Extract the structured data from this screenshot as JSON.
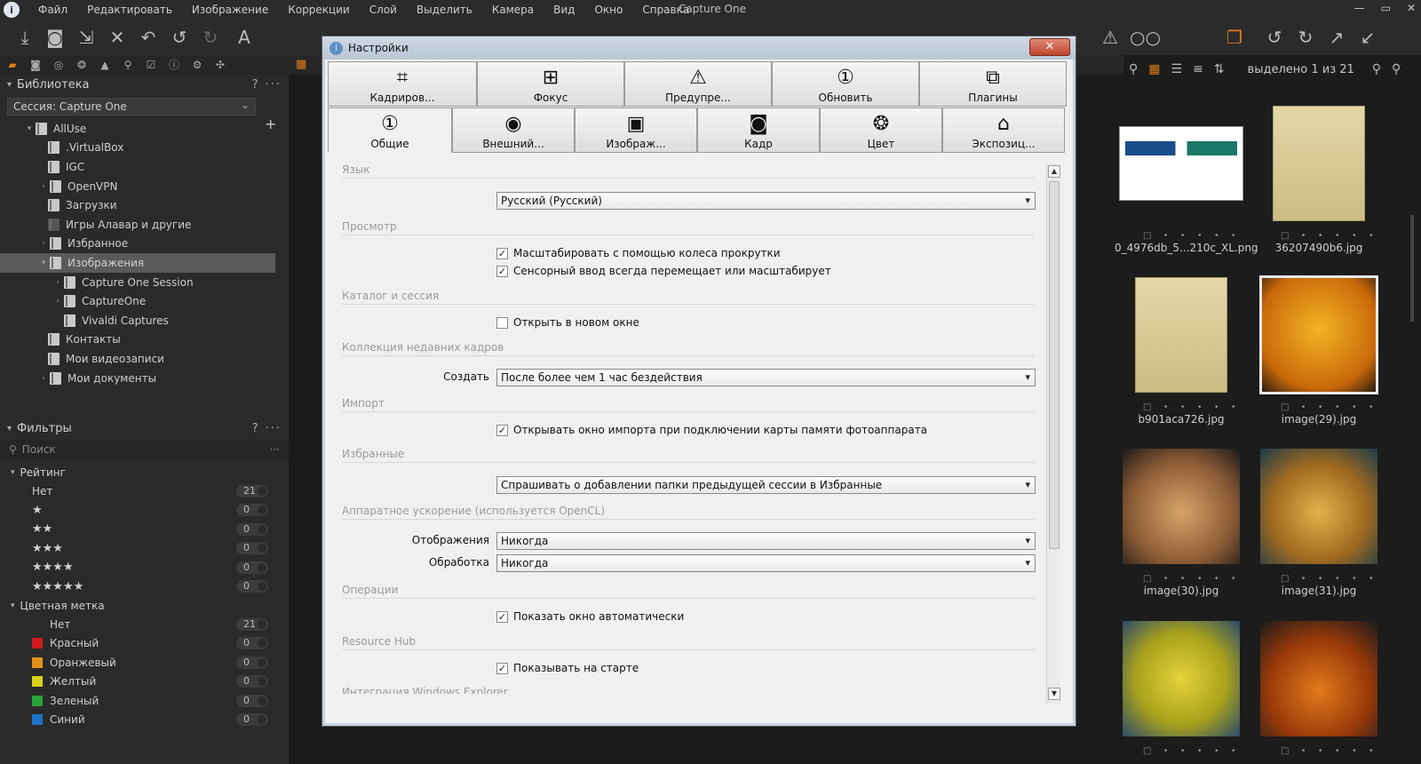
{
  "app": {
    "window_title": "Capture One",
    "menu": [
      "Файл",
      "Редактировать",
      "Изображение",
      "Коррекции",
      "Слой",
      "Выделить",
      "Камера",
      "Вид",
      "Окно",
      "Справка"
    ]
  },
  "library": {
    "header": "Библиотека",
    "session": "Сессия: Capture One",
    "tree": [
      {
        "label": "AllUse",
        "level": 1,
        "expanded": true
      },
      {
        "label": ".VirtualBox",
        "level": 2
      },
      {
        "label": "IGC",
        "level": 2
      },
      {
        "label": "OpenVPN",
        "level": 2,
        "collapsed": true
      },
      {
        "label": "Загрузки",
        "level": 2
      },
      {
        "label": "Игры Алавар и другие",
        "level": 2
      },
      {
        "label": "Избранное",
        "level": 2,
        "collapsed": true
      },
      {
        "label": "Изображения",
        "level": 2,
        "expanded": true,
        "selected": true
      },
      {
        "label": "Capture One Session",
        "level": 3,
        "collapsed": true
      },
      {
        "label": "CaptureOne",
        "level": 3,
        "collapsed": true
      },
      {
        "label": "Vivaldi Captures",
        "level": 3
      },
      {
        "label": "Контакты",
        "level": 2
      },
      {
        "label": "Мои видеозаписи",
        "level": 2
      },
      {
        "label": "Мои документы",
        "level": 2,
        "collapsed": true
      }
    ]
  },
  "filters": {
    "header": "Фильтры",
    "search_placeholder": "Поиск",
    "rating_header": "Рейтинг",
    "rating": [
      {
        "label": "Нет",
        "count": "21"
      },
      {
        "stars": "★",
        "count": "0"
      },
      {
        "stars": "★★",
        "count": "0"
      },
      {
        "stars": "★★★",
        "count": "0"
      },
      {
        "stars": "★★★★",
        "count": "0"
      },
      {
        "stars": "★★★★★",
        "count": "0"
      }
    ],
    "color_header": "Цветная метка",
    "colors": [
      {
        "label": "Нет",
        "count": "21",
        "color": "#2a2a2a"
      },
      {
        "label": "Красный",
        "count": "0",
        "color": "#d11a1a"
      },
      {
        "label": "Оранжевый",
        "count": "0",
        "color": "#e0901a"
      },
      {
        "label": "Желтый",
        "count": "0",
        "color": "#d8d21c"
      },
      {
        "label": "Зеленый",
        "count": "0",
        "color": "#2aa23a"
      },
      {
        "label": "Синий",
        "count": "0",
        "color": "#1e72c8"
      }
    ]
  },
  "browser": {
    "selection": "выделено 1 из 21",
    "thumbs": [
      {
        "name": "0_4976db_5...210c_XL.png"
      },
      {
        "name": "36207490b6.jpg"
      },
      {
        "name": "b901aca726.jpg"
      },
      {
        "name": "image(29).jpg"
      },
      {
        "name": "image(30).jpg"
      },
      {
        "name": "image(31).jpg"
      },
      {
        "name": ""
      },
      {
        "name": ""
      }
    ]
  },
  "dialog": {
    "title": "Настройки",
    "close": "✕",
    "tabs_top": [
      "Кадриров...",
      "Фокус",
      "Предупре...",
      "Обновить",
      "Плагины"
    ],
    "tabs_bottom": [
      "Общие",
      "Внешний...",
      "Изображ...",
      "Кадр",
      "Цвет",
      "Экспозиц..."
    ],
    "sections": {
      "language": "Язык",
      "view": "Просмотр",
      "catalog": "Каталог и сессия",
      "recent": "Коллекция недавних кадров",
      "import": "Импорт",
      "favorites": "Избранные",
      "hw": "Аппаратное ускорение (используется OpenCL)",
      "ops": "Операции",
      "hub": "Resource Hub",
      "explorer": "Интеграция Windows Explorer"
    },
    "language_value": "Русский (Русский)",
    "view_cb1": "Масштабировать с помощью колеса прокрутки",
    "view_cb2": "Сенсорный ввод всегда перемещает или масштабирует",
    "catalog_cb": "Открыть в новом окне",
    "recent_label": "Создать",
    "recent_value": "После более чем 1 час бездействия",
    "import_cb": "Открывать окно импорта при подключении карты памяти фотоаппарата",
    "favorites_value": "Спрашивать о добавлении папки предыдущей сессии в Избранные",
    "hw_display_label": "Отображения",
    "hw_display_value": "Никогда",
    "hw_proc_label": "Обработка",
    "hw_proc_value": "Никогда",
    "ops_cb": "Показать окно автоматически",
    "hub_cb": "Показывать на старте"
  }
}
